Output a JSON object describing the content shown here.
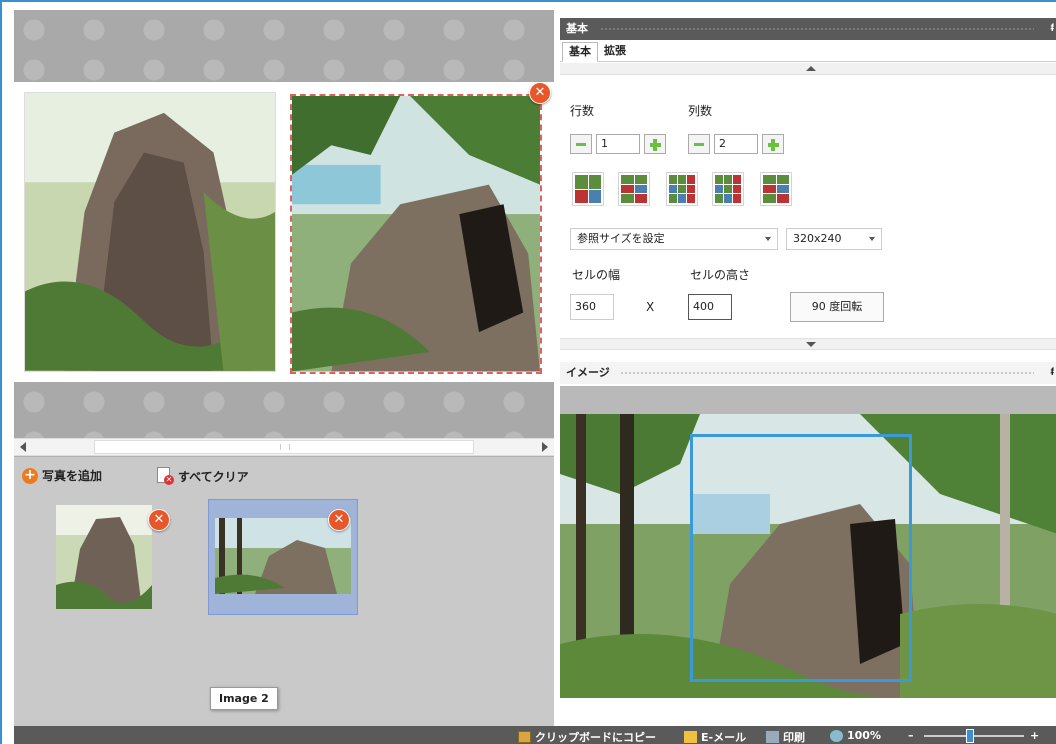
{
  "canvas": {
    "photos": [
      {
        "name": "photo-1",
        "selected": false
      },
      {
        "name": "photo-2",
        "selected": true
      }
    ]
  },
  "tray": {
    "add_photo_label": "写真を追加",
    "clear_all_label": "すべてクリア",
    "tooltip": "Image 2"
  },
  "panel": {
    "title": "基本",
    "pin": "ᵮ",
    "tabs": [
      "基本",
      "拡張"
    ],
    "rows_label": "行数",
    "rows_value": "1",
    "cols_label": "列数",
    "cols_value": "2",
    "size_select_value": "参照サイズを設定",
    "resolution_select_value": "320x240",
    "cell_width_label": "セルの幅",
    "cell_width_value": "360",
    "cell_height_label": "セルの高さ",
    "cell_height_value": "400",
    "separator": "X",
    "rotate_label": "90 度回転"
  },
  "image_panel": {
    "title": "イメージ",
    "pin": "ᵮ"
  },
  "status": {
    "clipboard_label": "クリップボードにコピー",
    "email_label": "E-メール",
    "print_label": "印刷",
    "zoom_label": "100%",
    "zoom_minus": "–",
    "zoom_plus": "+"
  },
  "colors": {
    "accent": "#3a8fd0",
    "selection_dash": "#e06060",
    "close_badge": "#e8572a",
    "crop_box": "#3a9ad9"
  }
}
